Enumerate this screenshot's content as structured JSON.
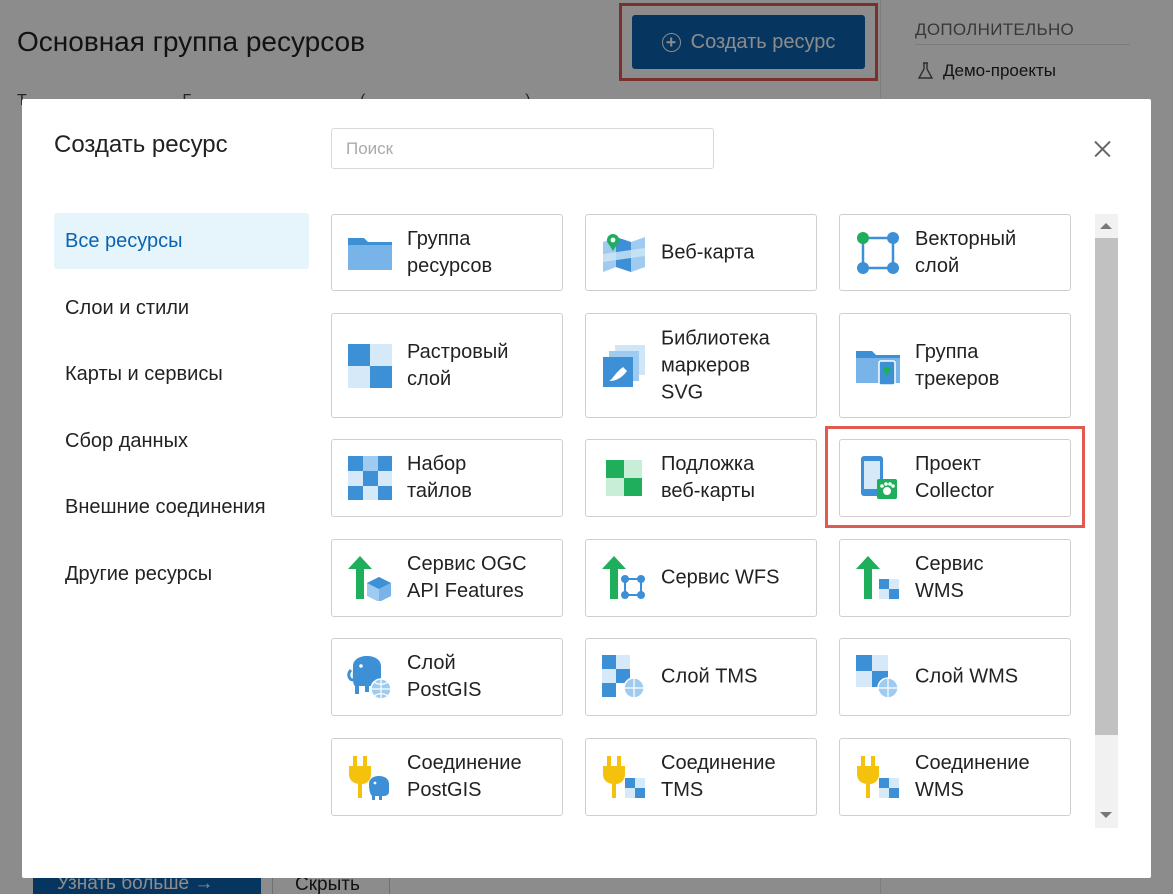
{
  "background": {
    "page_title": "Основная группа ресурсов",
    "create_button": {
      "label": "Создать ресурс",
      "icon": "plus-circle-icon"
    },
    "side_panel": {
      "heading": "ДОПОЛНИТЕЛЬНО",
      "items": [
        {
          "label": "Демо-проекты",
          "icon": "flask-icon"
        }
      ]
    },
    "bottom_buttons": {
      "learn_more": "Узнать больше →",
      "hide": "Скрыть"
    }
  },
  "modal": {
    "title": "Создать ресурс",
    "search": {
      "placeholder": "Поиск",
      "value": ""
    },
    "close_icon": "close-icon",
    "categories": [
      {
        "label": "Все ресурсы",
        "active": true
      },
      {
        "label": "Слои и стили",
        "active": false
      },
      {
        "label": "Карты и сервисы",
        "active": false
      },
      {
        "label": "Сбор данных",
        "active": false
      },
      {
        "label": "Внешние соединения",
        "active": false
      },
      {
        "label": "Другие ресурсы",
        "active": false
      }
    ],
    "resources": [
      {
        "label": "Группа\nресурсов",
        "icon": "folder-icon"
      },
      {
        "label": "Веб-карта",
        "icon": "webmap-icon"
      },
      {
        "label": "Векторный\nслой",
        "icon": "vector-layer-icon"
      },
      {
        "label": "Растровый\nслой",
        "icon": "raster-layer-icon"
      },
      {
        "label": "Библиотека\nмаркеров\nSVG",
        "icon": "svg-marker-library-icon"
      },
      {
        "label": "Группа\nтрекеров",
        "icon": "tracker-group-icon"
      },
      {
        "label": "Набор\nтайлов",
        "icon": "tileset-icon"
      },
      {
        "label": "Подложка\nвеб-карты",
        "icon": "basemap-icon"
      },
      {
        "label": "Проект\nCollector",
        "icon": "collector-project-icon"
      },
      {
        "label": "Сервис OGC\nAPI Features",
        "icon": "ogcf-service-icon"
      },
      {
        "label": "Сервис WFS",
        "icon": "wfs-service-icon"
      },
      {
        "label": "Сервис\nWMS",
        "icon": "wms-service-icon"
      },
      {
        "label": "Слой\nPostGIS",
        "icon": "postgis-layer-icon"
      },
      {
        "label": "Слой TMS",
        "icon": "tms-layer-icon"
      },
      {
        "label": "Слой WMS",
        "icon": "wms-layer-icon"
      },
      {
        "label": "Соединение\nPostGIS",
        "icon": "postgis-connection-icon"
      },
      {
        "label": "Соединение\nTMS",
        "icon": "tms-connection-icon"
      },
      {
        "label": "Соединение\nWMS",
        "icon": "wms-connection-icon"
      }
    ]
  },
  "colors": {
    "primary": "#0b63b0",
    "highlight": "#e05a4f",
    "active_category_bg": "#e6f4fc",
    "icon_blue": "#3d8fd6",
    "icon_light_blue": "#9ecbef",
    "icon_green": "#1fae5b",
    "icon_yellow": "#f4c20d"
  }
}
